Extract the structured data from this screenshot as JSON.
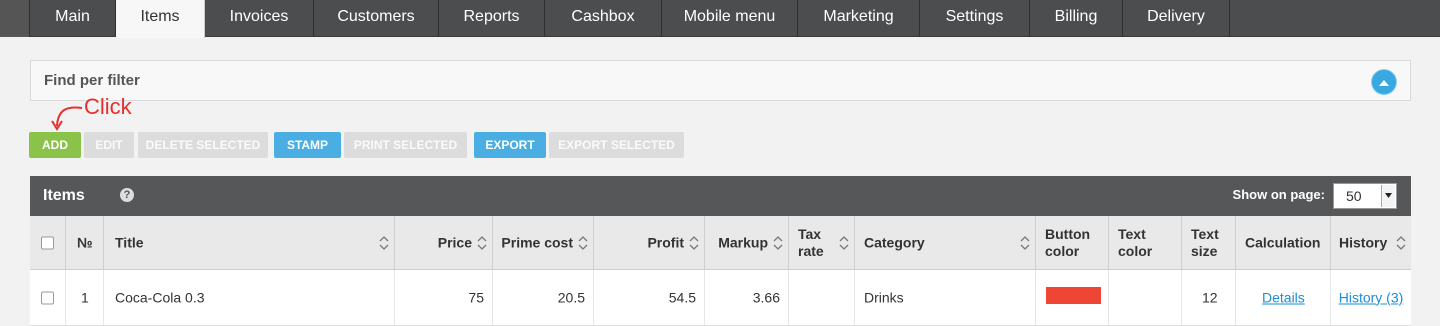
{
  "nav": {
    "tabs": [
      {
        "label": "Main"
      },
      {
        "label": "Items",
        "active": true
      },
      {
        "label": "Invoices"
      },
      {
        "label": "Customers"
      },
      {
        "label": "Reports"
      },
      {
        "label": "Cashbox"
      },
      {
        "label": "Mobile menu"
      },
      {
        "label": "Marketing"
      },
      {
        "label": "Settings"
      },
      {
        "label": "Billing"
      },
      {
        "label": "Delivery"
      }
    ]
  },
  "filter": {
    "label": "Find per filter"
  },
  "annotation": {
    "text": "Click",
    "color": "#e53030"
  },
  "toolbar": {
    "add": "ADD",
    "edit": "EDIT",
    "delete_selected": "DELETE SELECTED",
    "stamp": "STAMP",
    "print_selected": "PRINT SELECTED",
    "export": "EXPORT",
    "export_selected": "EXPORT SELECTED"
  },
  "panel": {
    "title": "Items",
    "help_icon": "question-circle-icon",
    "show_on_page_label": "Show on page:",
    "page_size": "50"
  },
  "table": {
    "headers": {
      "num": "№",
      "title": "Title",
      "price": "Price",
      "prime_cost": "Prime cost",
      "profit": "Profit",
      "markup": "Markup",
      "tax_rate": "Tax rate",
      "category": "Category",
      "button_color": "Button color",
      "text_color": "Text color",
      "text_size": "Text size",
      "calculation": "Calculation",
      "history": "History"
    },
    "rows": [
      {
        "num": "1",
        "title": "Coca-Cola 0.3",
        "price": "75",
        "prime_cost": "20.5",
        "profit": "54.5",
        "markup": "3.66",
        "tax_rate": "",
        "category": "Drinks",
        "button_color": "#ee4535",
        "text_color": "#ffffff",
        "text_size": "12",
        "calculation": "Details",
        "history": "History (3)"
      }
    ]
  },
  "colors": {
    "nav_bg": "#4c4d4f",
    "accent_green": "#8bc34a",
    "accent_blue": "#4aaee2",
    "link": "#1a8fd6"
  }
}
